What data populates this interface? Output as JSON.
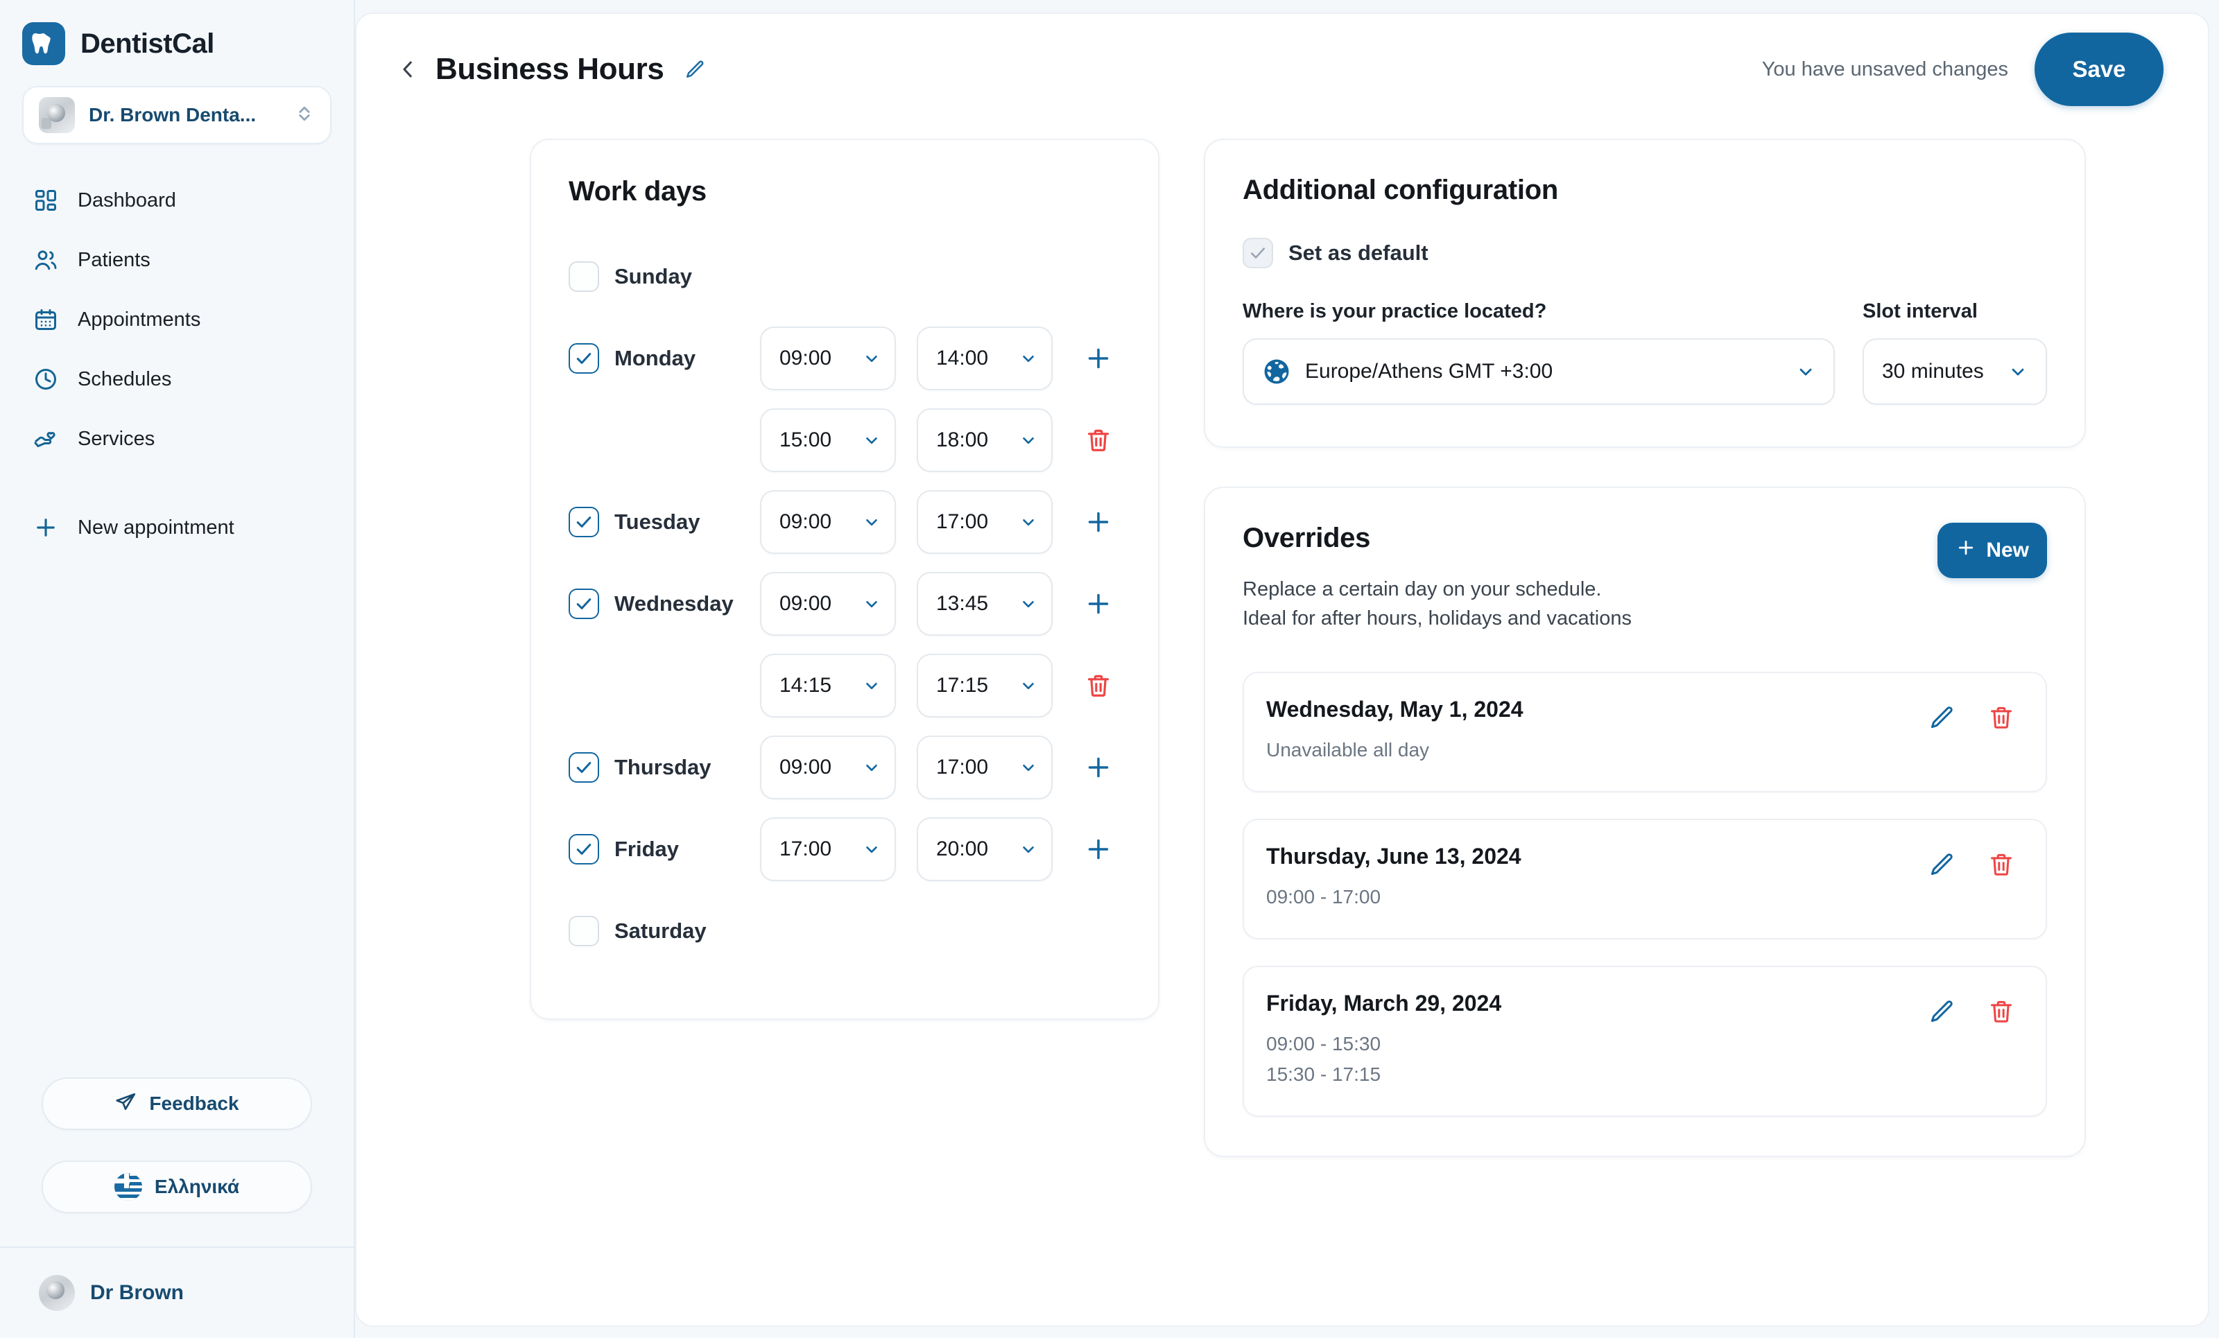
{
  "brand": {
    "name": "DentistCal",
    "logo_icon": "tooth-icon",
    "logo_color": "#1a6ba3"
  },
  "org_selector": {
    "name": "Dr. Brown Denta...",
    "caret_icon": "chevron-up-down-icon"
  },
  "sidebar": {
    "items": [
      {
        "label": "Dashboard",
        "icon": "dashboard-grid-icon"
      },
      {
        "label": "Patients",
        "icon": "users-icon"
      },
      {
        "label": "Appointments",
        "icon": "calendar-icon"
      },
      {
        "label": "Schedules",
        "icon": "clock-icon"
      },
      {
        "label": "Services",
        "icon": "hand-heart-icon"
      }
    ],
    "new_appointment": {
      "label": "New appointment",
      "icon": "plus-icon"
    },
    "feedback": {
      "label": "Feedback",
      "icon": "paper-plane-icon"
    },
    "language": {
      "label": "Ελληνικά",
      "icon": "greek-flag-icon"
    },
    "user": {
      "name": "Dr Brown",
      "avatar": "user-avatar"
    }
  },
  "header": {
    "back_icon": "chevron-left-icon",
    "title": "Business Hours",
    "edit_icon": "pencil-icon",
    "unsaved_text": "You have unsaved changes",
    "save_label": "Save",
    "accent_color": "#1266a0"
  },
  "workdays": {
    "title": "Work days",
    "add_icon": "plus-icon",
    "delete_icon": "trash-icon",
    "days": [
      {
        "name": "Sunday",
        "checked": false,
        "slots": []
      },
      {
        "name": "Monday",
        "checked": true,
        "slots": [
          {
            "from": "09:00",
            "to": "14:00"
          },
          {
            "from": "15:00",
            "to": "18:00"
          }
        ]
      },
      {
        "name": "Tuesday",
        "checked": true,
        "slots": [
          {
            "from": "09:00",
            "to": "17:00"
          }
        ]
      },
      {
        "name": "Wednesday",
        "checked": true,
        "slots": [
          {
            "from": "09:00",
            "to": "13:45"
          },
          {
            "from": "14:15",
            "to": "17:15"
          }
        ]
      },
      {
        "name": "Thursday",
        "checked": true,
        "slots": [
          {
            "from": "09:00",
            "to": "17:00"
          }
        ]
      },
      {
        "name": "Friday",
        "checked": true,
        "slots": [
          {
            "from": "17:00",
            "to": "20:00"
          }
        ]
      },
      {
        "name": "Saturday",
        "checked": false,
        "slots": []
      }
    ]
  },
  "additional_config": {
    "title": "Additional configuration",
    "set_default": {
      "label": "Set as default",
      "checked": true,
      "disabled": true
    },
    "timezone": {
      "label": "Where is your practice located?",
      "value": "Europe/Athens GMT +3:00",
      "icon": "globe-icon"
    },
    "slot_interval": {
      "label": "Slot interval",
      "value": "30 minutes"
    }
  },
  "overrides": {
    "title": "Overrides",
    "description_line1": "Replace a certain day on your schedule.",
    "description_line2": "Ideal for after hours, holidays and vacations",
    "new_label": "New",
    "new_icon": "plus-icon",
    "edit_icon": "pencil-icon",
    "delete_icon": "trash-icon",
    "items": [
      {
        "date": "Wednesday, May 1, 2024",
        "times": [
          "Unavailable all day"
        ]
      },
      {
        "date": "Thursday, June 13, 2024",
        "times": [
          "09:00 - 17:00"
        ]
      },
      {
        "date": "Friday, March 29, 2024",
        "times": [
          "09:00 - 15:30",
          "15:30 - 17:15"
        ]
      }
    ]
  }
}
